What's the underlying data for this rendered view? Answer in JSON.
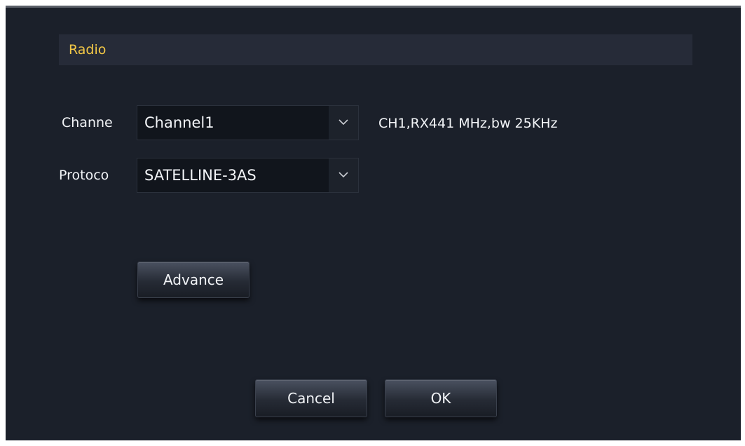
{
  "dialog": {
    "title": "Radio"
  },
  "channel": {
    "label": "Channe",
    "value": "Channel1",
    "info": "CH1,RX441 MHz,bw 25KHz"
  },
  "protocol": {
    "label": "Protoco",
    "value": "SATELLINE-3AS"
  },
  "buttons": {
    "advance": "Advance",
    "cancel": "Cancel",
    "ok": "OK"
  },
  "icons": {
    "dropdown": "chevron-down-icon"
  },
  "colors": {
    "title": "#f3c846",
    "background": "#1b202a",
    "header_bar": "#262b38"
  }
}
